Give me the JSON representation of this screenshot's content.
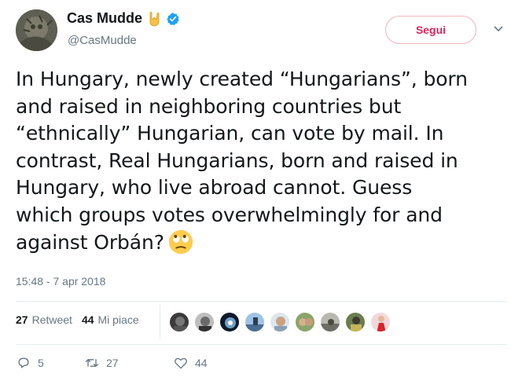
{
  "user": {
    "display_name": "Cas Mudde",
    "handle": "@CasMudde",
    "name_emoji": "sign-of-the-horns-emoji",
    "verified_icon": "verified-badge-icon",
    "verified_color": "#1da1f2"
  },
  "follow_button": {
    "label": "Segui",
    "color": "#e0245e"
  },
  "tweet": {
    "lines": [
      "In Hungary, newly created “Hungarians”, born",
      "and raised in neighboring countries but",
      "“ethnically” Hungarian, can vote by mail. In",
      "contrast, Real Hungarians, born and raised in",
      "Hungary, who live abroad cannot. Guess",
      "which groups votes overwhelmingly for and",
      "against Orbán?"
    ],
    "end_emoji": "face-with-rolling-eyes-emoji",
    "timestamp": "15:48 - 7 apr 2018"
  },
  "stats": {
    "retweets_count": "27",
    "retweets_label": "Retweet",
    "likes_count": "44",
    "likes_label": "Mi piace"
  },
  "likers": [
    "liker-avatar-1",
    "liker-avatar-2",
    "liker-avatar-3",
    "liker-avatar-4",
    "liker-avatar-5",
    "liker-avatar-6",
    "liker-avatar-7",
    "liker-avatar-8",
    "liker-avatar-9"
  ],
  "actions": {
    "reply_count": "5",
    "retweet_count": "27",
    "like_count": "44"
  },
  "colors": {
    "text": "#14171a",
    "secondary": "#657786",
    "divider": "#e6ecf0"
  }
}
